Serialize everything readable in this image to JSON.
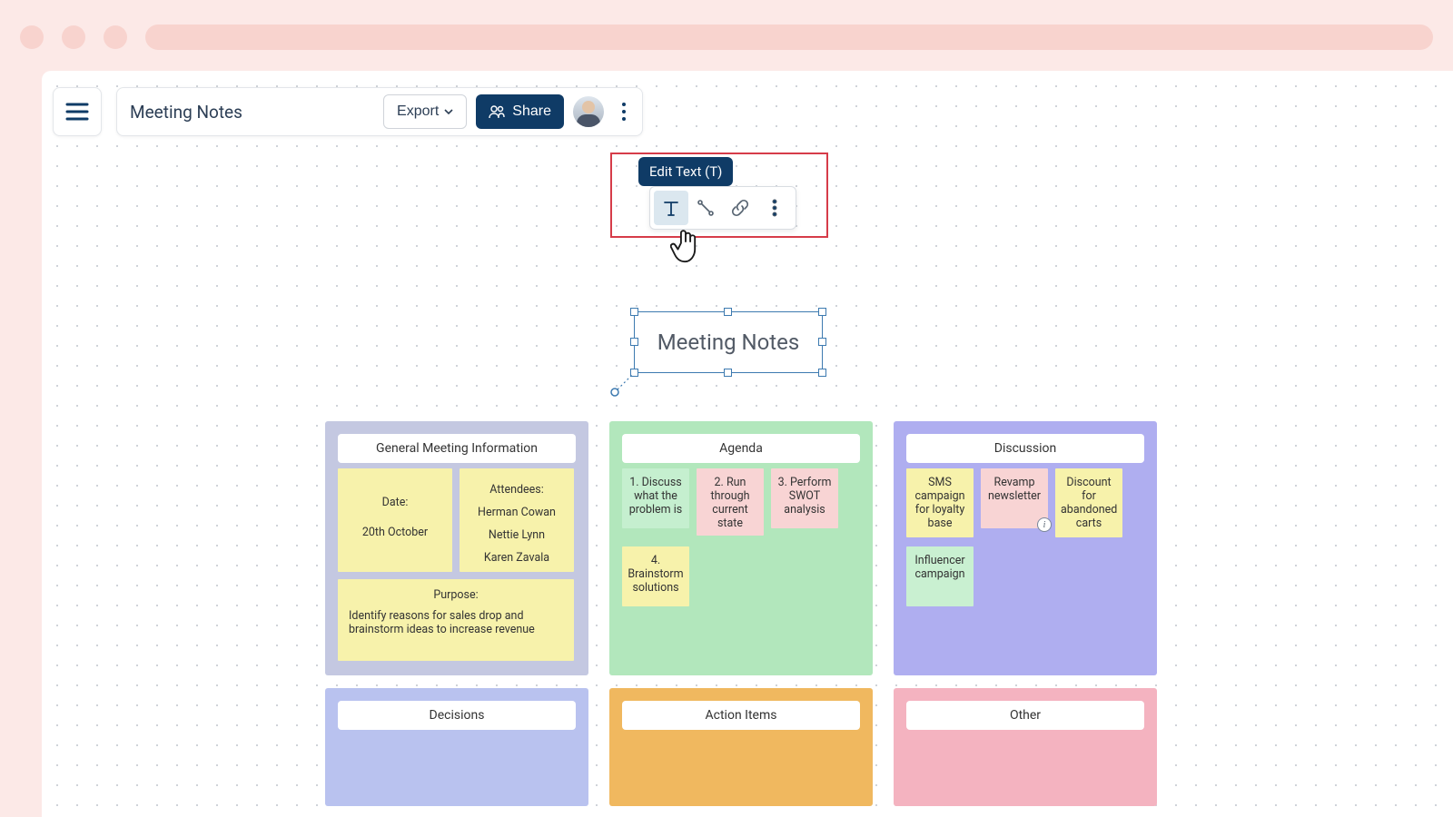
{
  "topbar": {
    "doc_title": "Meeting Notes",
    "export_label": "Export",
    "share_label": "Share"
  },
  "tooltip": {
    "edit_text": "Edit Text (T)"
  },
  "selected_node": {
    "text": "Meeting Notes"
  },
  "panels": {
    "general": {
      "title": "General Meeting Information",
      "date_label": "Date:",
      "date_value": "20th October",
      "attendees_label": "Attendees:",
      "attendees": [
        "Herman Cowan",
        "Nettie Lynn",
        "Karen Zavala"
      ],
      "purpose_label": "Purpose:",
      "purpose_text": "Identify reasons for sales drop and brainstorm ideas to increase revenue"
    },
    "agenda": {
      "title": "Agenda",
      "items": [
        "1. Discuss what the problem is",
        "2. Run through current state",
        "3. Perform SWOT analysis",
        "4. Brainstorm solutions"
      ]
    },
    "discussion": {
      "title": "Discussion",
      "items": [
        "SMS campaign for loyalty base",
        "Revamp newsletter",
        "Discount for abandoned carts",
        "Influencer campaign"
      ]
    },
    "decisions": {
      "title": "Decisions"
    },
    "action_items": {
      "title": "Action Items"
    },
    "other": {
      "title": "Other"
    }
  }
}
